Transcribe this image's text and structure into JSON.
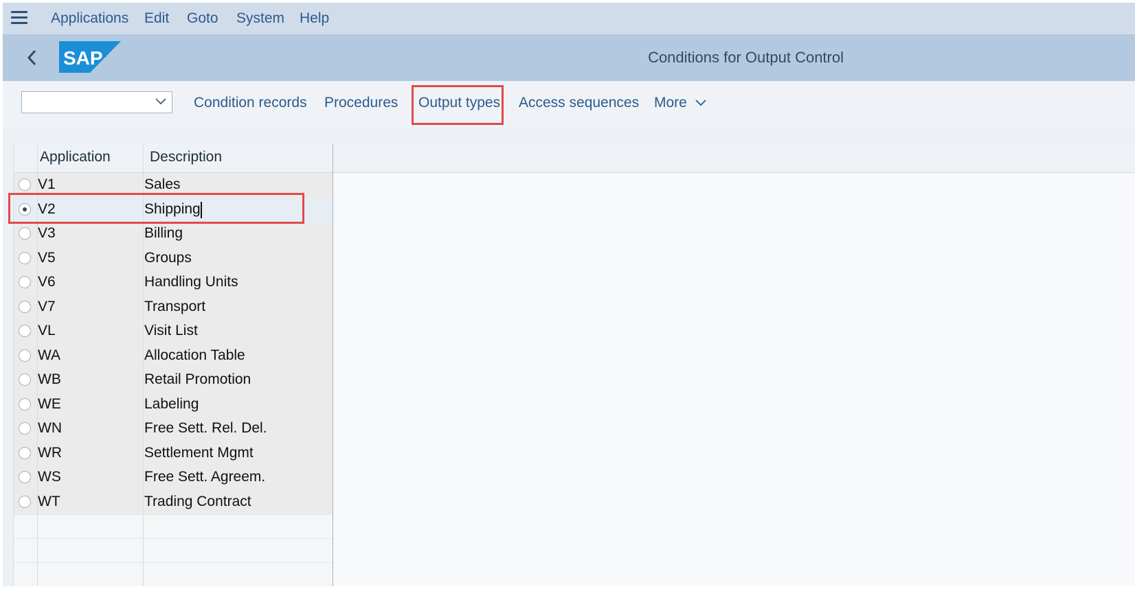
{
  "menubar": {
    "items": [
      "Applications",
      "Edit",
      "Goto",
      "System",
      "Help"
    ]
  },
  "shell": {
    "title": "Conditions for Output Control",
    "logo_text": "SAP"
  },
  "toolbar": {
    "dropdown_value": "",
    "buttons": [
      "Condition records",
      "Procedures",
      "Output types",
      "Access sequences"
    ],
    "more_label": "More"
  },
  "table": {
    "headers": {
      "application": "Application",
      "description": "Description"
    },
    "rows": [
      {
        "code": "V1",
        "description": "Sales",
        "selected": false
      },
      {
        "code": "V2",
        "description": "Shipping",
        "selected": true
      },
      {
        "code": "V3",
        "description": "Billing",
        "selected": false
      },
      {
        "code": "V5",
        "description": "Groups",
        "selected": false
      },
      {
        "code": "V6",
        "description": "Handling Units",
        "selected": false
      },
      {
        "code": "V7",
        "description": "Transport",
        "selected": false
      },
      {
        "code": "VL",
        "description": "Visit List",
        "selected": false
      },
      {
        "code": "WA",
        "description": "Allocation Table",
        "selected": false
      },
      {
        "code": "WB",
        "description": "Retail Promotion",
        "selected": false
      },
      {
        "code": "WE",
        "description": "Labeling",
        "selected": false
      },
      {
        "code": "WN",
        "description": "Free Sett. Rel. Del.",
        "selected": false
      },
      {
        "code": "WR",
        "description": "Settlement Mgmt",
        "selected": false
      },
      {
        "code": "WS",
        "description": "Free Sett. Agreem.",
        "selected": false
      },
      {
        "code": "WT",
        "description": "Trading Contract",
        "selected": false
      }
    ]
  },
  "colors": {
    "menubar_bg": "#d0dcea",
    "shellbar_bg": "#b2c9e0",
    "link_blue": "#2c5a8c",
    "highlight_red": "#e04a4a",
    "logo_blue": "#1a8fd8"
  },
  "icons": {
    "menu": "hamburger-icon",
    "back": "chevron-left-icon",
    "dropdown": "chevron-down-icon"
  }
}
